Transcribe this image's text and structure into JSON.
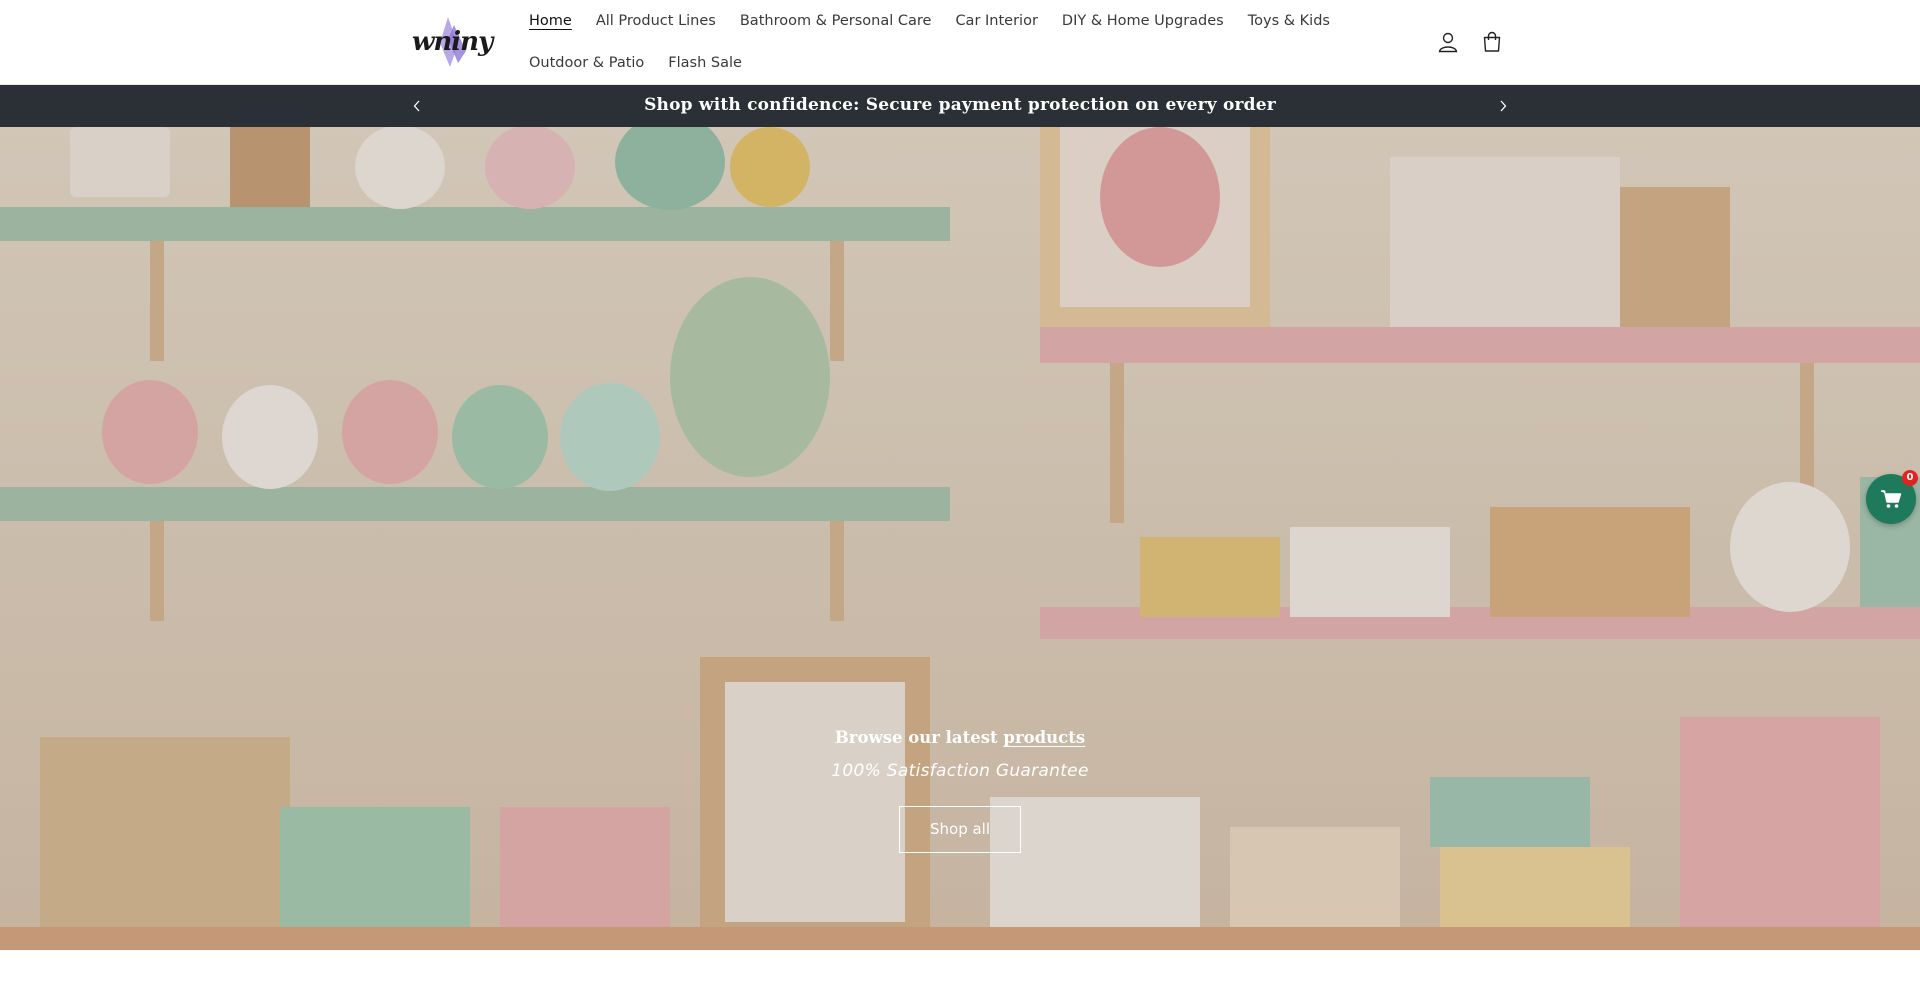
{
  "brand": {
    "logo_text": "wniny"
  },
  "nav": {
    "row1": [
      {
        "label": "Home",
        "active": true
      },
      {
        "label": "All Product Lines"
      },
      {
        "label": "Bathroom & Personal Care"
      },
      {
        "label": "Car Interior"
      },
      {
        "label": "DIY & Home Upgrades"
      },
      {
        "label": "Toys & Kids"
      }
    ],
    "row2": [
      {
        "label": "Outdoor & Patio"
      },
      {
        "label": "Flash Sale"
      }
    ]
  },
  "header_icons": {
    "account": "account-icon",
    "cart": "cart-icon"
  },
  "announcement": {
    "text": "Shop with confidence: Secure payment protection on every order",
    "prev_icon": "chevron-left-icon",
    "next_icon": "chevron-right-icon"
  },
  "hero": {
    "heading_prefix": "Browse our latest",
    "heading_link": "products",
    "subheading": "100% Satisfaction Guarantee",
    "button_label": "Shop all"
  },
  "floating_cart": {
    "count": "0",
    "icon": "shopping-cart-icon",
    "color": "#1f7a5c"
  },
  "colors": {
    "announcement_bg": "#2b3036",
    "badge": "#e02424"
  }
}
